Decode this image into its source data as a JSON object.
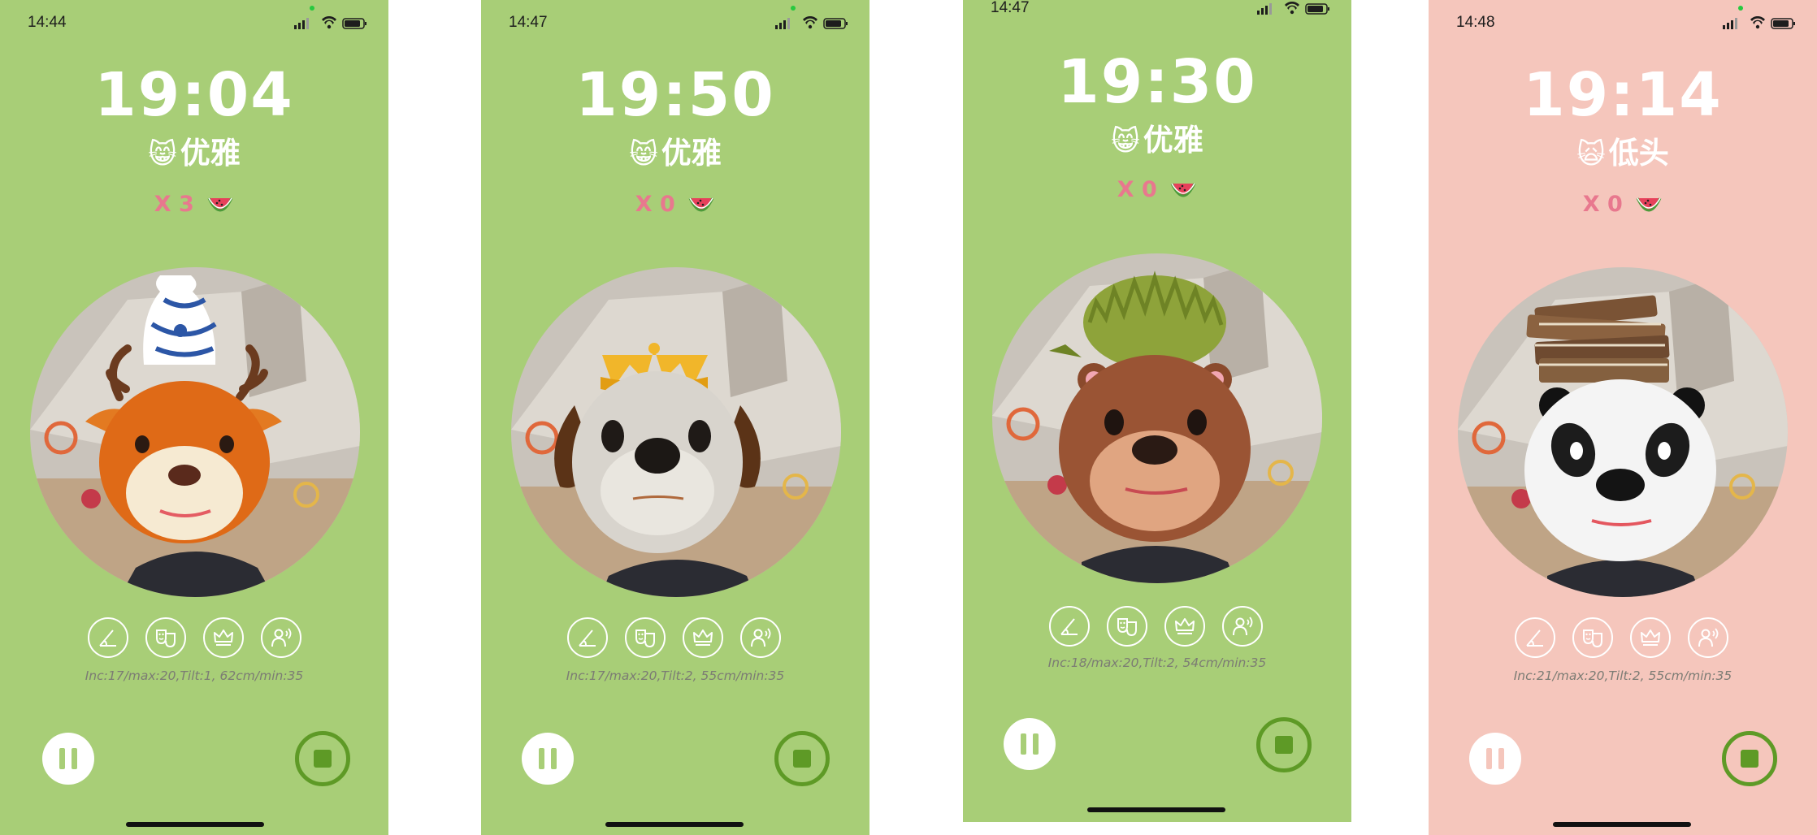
{
  "colors": {
    "green_bg": "#a8ce77",
    "pink_bg": "#f5c6bc",
    "counter_pink": "#e8788e",
    "stop_green": "#5e9a26"
  },
  "screens": [
    {
      "status_time": "14:44",
      "timer": "19:04",
      "posture_emoji": "😸",
      "posture_label": "优雅",
      "count": "X 3",
      "camera_overlay": "deer-with-vase",
      "metrics": "Inc:17/max:20,Tilt:1, 62cm/min:35",
      "icons": [
        "angle-icon",
        "masks-icon",
        "crown-icon",
        "voice-icon"
      ]
    },
    {
      "status_time": "14:47",
      "timer": "19:50",
      "posture_emoji": "😸",
      "posture_label": "优雅",
      "count": "X 0",
      "camera_overlay": "dog-with-crown",
      "metrics": "Inc:17/max:20,Tilt:2, 55cm/min:35",
      "icons": [
        "angle-icon",
        "masks-icon",
        "crown-icon",
        "voice-icon"
      ]
    },
    {
      "status_time": "14:47",
      "timer": "19:30",
      "posture_emoji": "😸",
      "posture_label": "优雅",
      "count": "X 0",
      "camera_overlay": "bear-with-durian",
      "metrics": "Inc:18/max:20,Tilt:2, 54cm/min:35",
      "icons": [
        "angle-icon",
        "masks-icon",
        "crown-icon",
        "voice-icon"
      ]
    },
    {
      "status_time": "14:48",
      "timer": "19:14",
      "posture_emoji": "🙀",
      "posture_label": "低头",
      "count": "X 0",
      "camera_overlay": "panda-with-books",
      "metrics": "Inc:21/max:20,Tilt:2, 55cm/min:35",
      "icons": [
        "angle-icon",
        "masks-icon",
        "crown-icon",
        "voice-icon"
      ]
    }
  ]
}
